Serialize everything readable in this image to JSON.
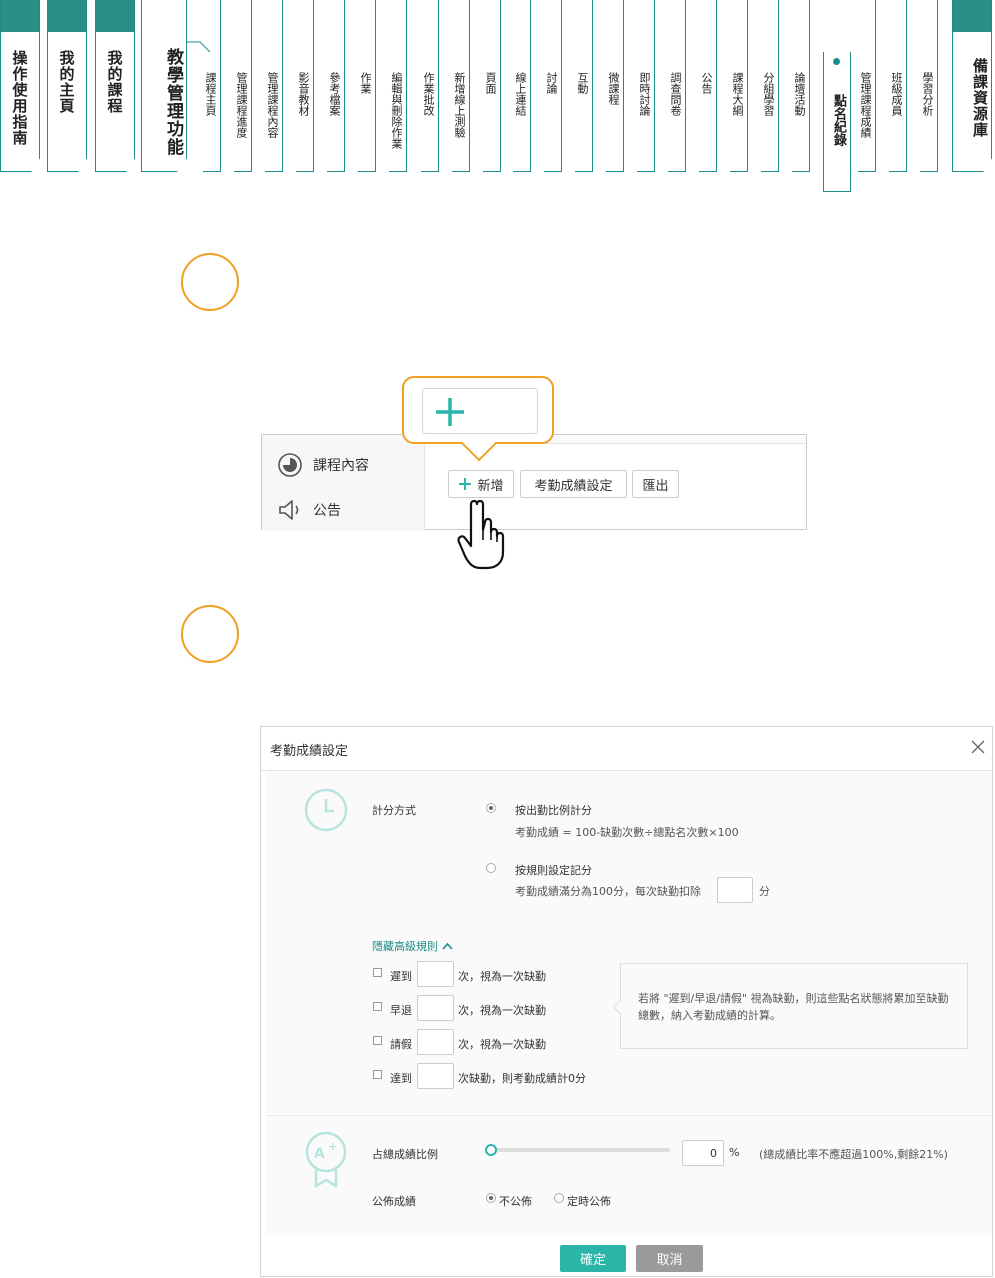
{
  "nav": {
    "main_tabs": [
      {
        "label": "操作使用指南"
      },
      {
        "label": "我的主頁"
      },
      {
        "label": "我的課程"
      }
    ],
    "teach_tab": "教學管理功能",
    "backup_tab": "備課資源庫",
    "sub_tabs": [
      "課程主頁",
      "管理課程進度",
      "管理課程內容",
      "影音教材",
      "參考檔案",
      "作業",
      "編輯與刪除作業",
      "作業批改",
      "新增線上測驗",
      "頁面",
      "線上連結",
      "討論",
      "互動",
      "微課程",
      "即時討論",
      "調查問卷",
      "公告",
      "課程大綱",
      "分組學習",
      "論壇活動",
      "點名紀錄",
      "管理課程成績",
      "班級成員",
      "學習分析"
    ],
    "active_sub_tab": "點名紀錄",
    "accent_color": "#1c8c8a"
  },
  "step1": {
    "sidebar_items": [
      {
        "label": "課程內容",
        "icon": "pie-chart-icon"
      },
      {
        "label": "公告",
        "icon": "speaker-icon"
      }
    ],
    "toolbar": {
      "add_label": "新增",
      "attendance_label": "考勤成績設定",
      "export_label": "匯出"
    },
    "callout_icon": "plus-icon",
    "pointer_icon": "hand-pointer-icon",
    "highlight_color": "#f0a020"
  },
  "modal": {
    "title": "考勤成績設定",
    "scoring": {
      "label": "計分方式",
      "option1_label": "按出勤比例計分",
      "option1_formula": "考勤成績 = 100-缺勤次數÷總點名次數×100",
      "option2_label": "按規則設定記分",
      "option2_desc": "考勤成績滿分為100分，每次缺勤扣除",
      "option2_unit": "分",
      "selected": "option1"
    },
    "advanced": {
      "toggle_label": "隱藏高級規則",
      "rules": [
        {
          "label": "遲到",
          "suffix": "次，視為一次缺勤"
        },
        {
          "label": "早退",
          "suffix": "次，視為一次缺勤"
        },
        {
          "label": "請假",
          "suffix": "次，視為一次缺勤"
        },
        {
          "label": "達到",
          "suffix": "次缺勤，則考勤成績計0分"
        }
      ],
      "note": "若將 \"遲到/早退/請假\" 視為缺勤，則這些點名狀態將累加至缺勤總數，納入考勤成績的計算。"
    },
    "weight": {
      "label": "占總成績比例",
      "value": "0",
      "unit": "%",
      "slider_fraction": 0,
      "hint": "(總成績比率不應超過100%,剩餘21%)"
    },
    "publish": {
      "label": "公佈成績",
      "option_no": "不公佈",
      "option_timed": "定時公佈",
      "selected": "no"
    },
    "ok_label": "確定",
    "cancel_label": "取消",
    "primary_color": "#2bb5a8"
  }
}
